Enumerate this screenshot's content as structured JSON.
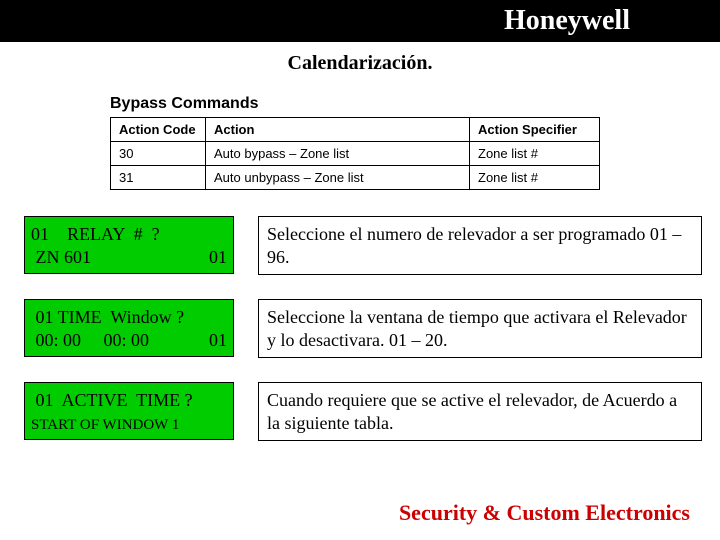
{
  "header": {
    "brand": "Honeywell"
  },
  "subtitle": "Calendarización.",
  "table": {
    "title": "Bypass Commands",
    "headers": [
      "Action Code",
      "Action",
      "Action Specifier"
    ],
    "rows": [
      [
        "30",
        "Auto bypass – Zone list",
        "Zone list #"
      ],
      [
        "31",
        "Auto unbypass – Zone list",
        "Zone list #"
      ]
    ]
  },
  "panels": [
    {
      "lcd_line1": "01    RELAY  #  ?",
      "lcd_line2_left": " ZN 601",
      "lcd_line2_right": "01",
      "lcd_size": "normal",
      "desc": "Seleccione el numero de relevador a ser programado 01 – 96."
    },
    {
      "lcd_line1": " 01 TIME  Window ?",
      "lcd_line2_left": " 00: 00     00: 00",
      "lcd_line2_right": "01",
      "lcd_size": "normal",
      "desc": "Seleccione la ventana de tiempo que activara el Relevador y lo desactivara.\n01 – 20."
    },
    {
      "lcd_line1": " 01  ACTIVE  TIME ?",
      "lcd_line2_left": "START OF WINDOW 1",
      "lcd_line2_right": "",
      "lcd_size": "small",
      "desc": "Cuando requiere que se active el relevador, de Acuerdo a la siguiente tabla."
    }
  ],
  "footer": "Security & Custom Electronics"
}
